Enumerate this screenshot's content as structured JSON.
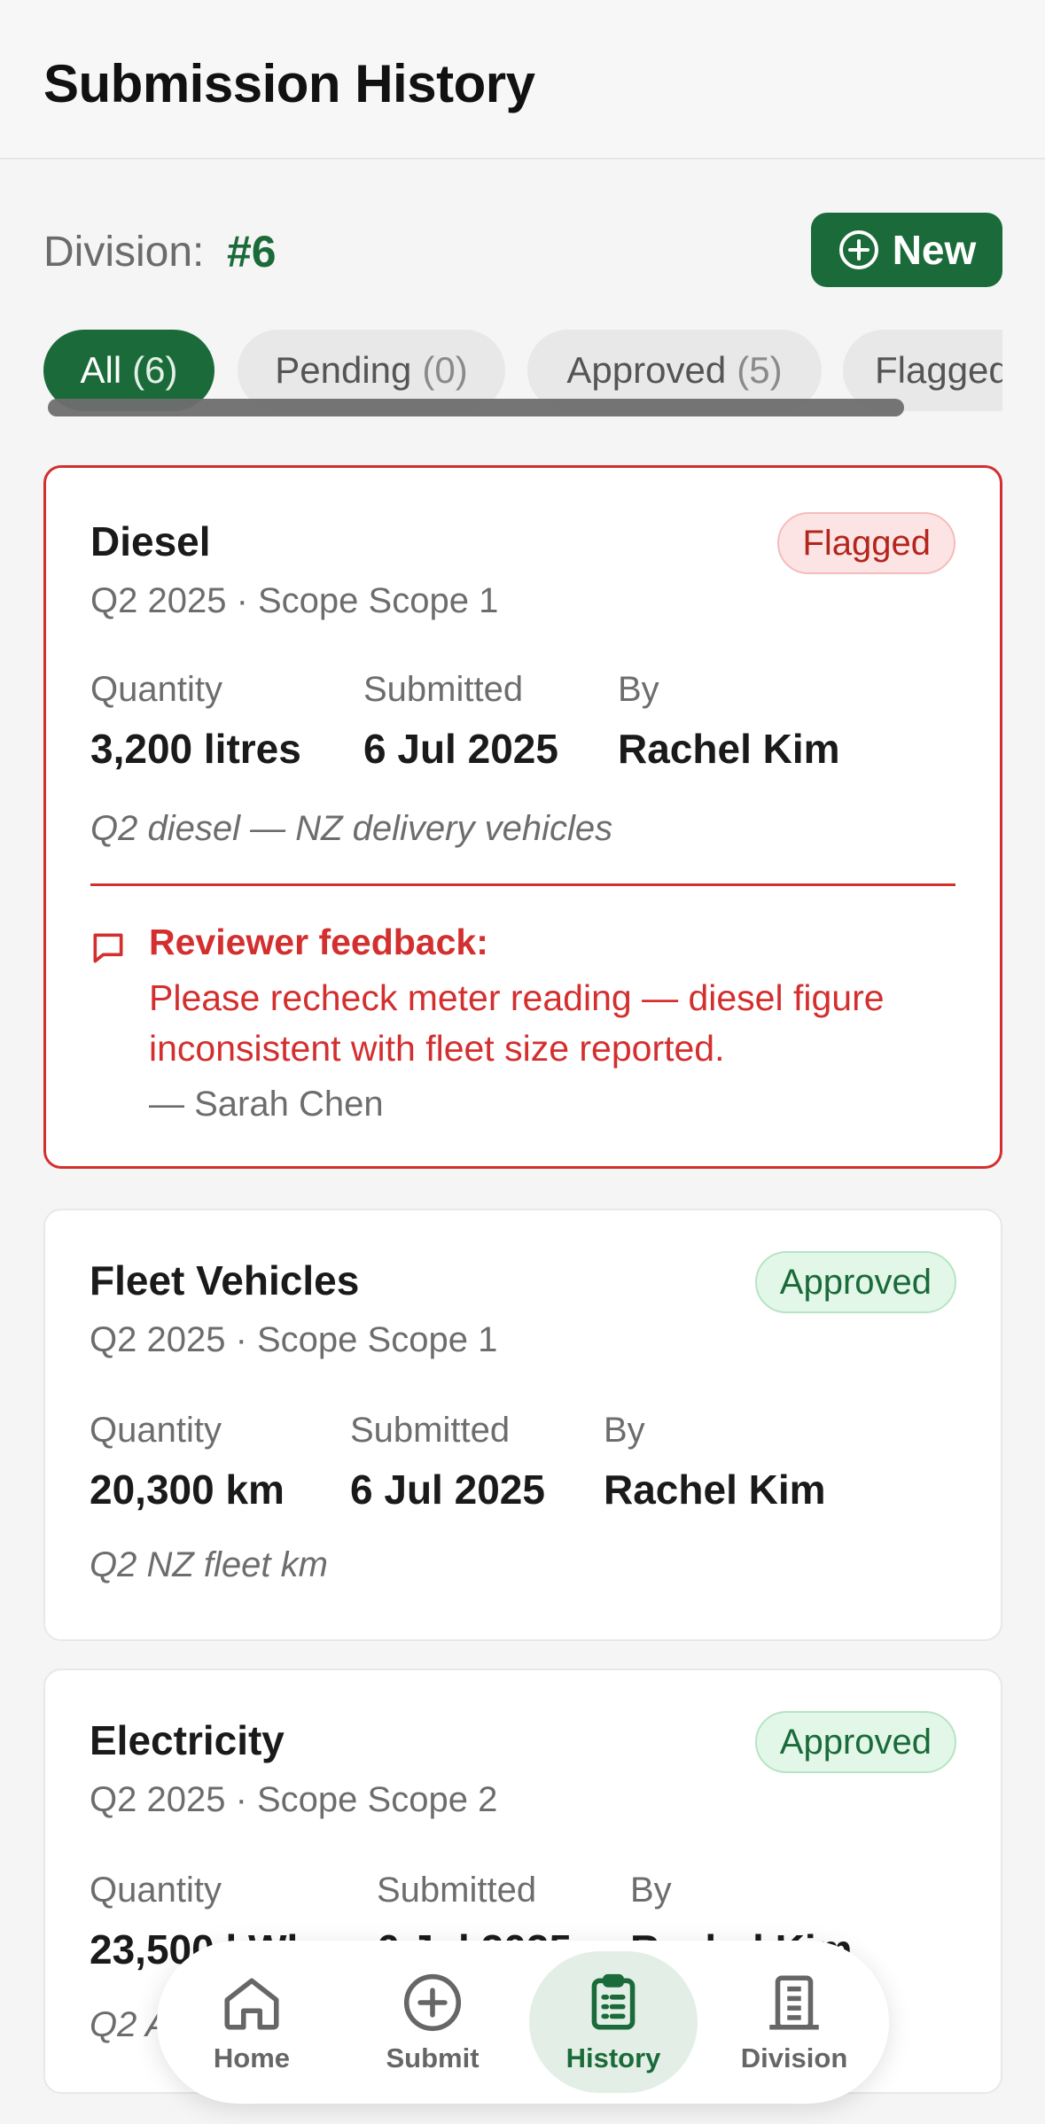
{
  "header": {
    "title": "Submission History"
  },
  "division": {
    "label": "Division:",
    "value": "#6"
  },
  "new_button": {
    "label": "New",
    "icon": "plus-circle-icon"
  },
  "filters": [
    {
      "label": "All",
      "count": "(6)",
      "active": true
    },
    {
      "label": "Pending",
      "count": "(0)",
      "active": false
    },
    {
      "label": "Approved",
      "count": "(5)",
      "active": false
    },
    {
      "label": "Flagged",
      "count": "",
      "active": false
    }
  ],
  "meta_labels": {
    "quantity": "Quantity",
    "submitted": "Submitted",
    "by": "By"
  },
  "submissions": [
    {
      "title": "Diesel",
      "subtitle": "Q2 2025 · Scope Scope 1",
      "status": "Flagged",
      "quantity": "3,200 litres",
      "submitted": "6 Jul 2025",
      "by": "Rachel Kim",
      "note": "Q2 diesel — NZ delivery vehicles",
      "feedback": {
        "title": "Reviewer feedback:",
        "text": "Please recheck meter reading — diesel figure inconsistent with fleet size reported.",
        "author": "— Sarah Chen"
      }
    },
    {
      "title": "Fleet Vehicles",
      "subtitle": "Q2 2025 · Scope Scope 1",
      "status": "Approved",
      "quantity": "20,300 km",
      "submitted": "6 Jul 2025",
      "by": "Rachel Kim",
      "note": "Q2 NZ fleet km"
    },
    {
      "title": "Electricity",
      "subtitle": "Q2 2025 · Scope Scope 2",
      "status": "Approved",
      "quantity": "23,500 kWh",
      "submitted": "6 Jul 2025",
      "by": "Rachel Kim",
      "note": "Q2 A"
    }
  ],
  "nav": [
    {
      "label": "Home",
      "icon": "home-icon",
      "active": false
    },
    {
      "label": "Submit",
      "icon": "plus-circle-icon",
      "active": false
    },
    {
      "label": "History",
      "icon": "clipboard-icon",
      "active": true
    },
    {
      "label": "Division",
      "icon": "building-icon",
      "active": false
    }
  ],
  "colors": {
    "brand": "#1b6b3a",
    "flagged": "#d32f2f",
    "approved_bg": "#e3f7e9"
  }
}
